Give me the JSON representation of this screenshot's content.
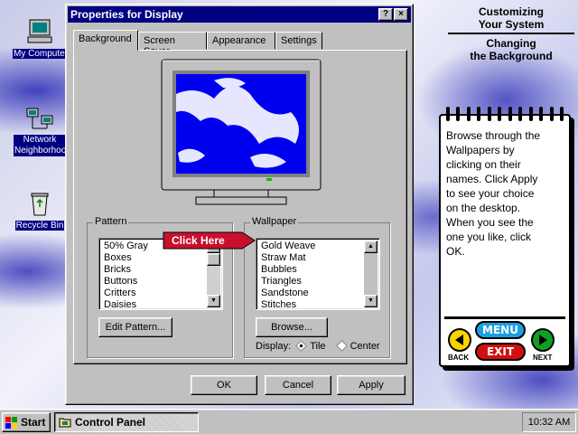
{
  "desktop": {
    "icons": [
      {
        "label": "My Computer",
        "icon": "computer-icon"
      },
      {
        "label": "Network Neighborhood",
        "icon": "network-icon"
      },
      {
        "label": "Recycle Bin",
        "icon": "recycle-bin-icon"
      }
    ]
  },
  "dialog": {
    "title": "Properties for Display",
    "help_button": "?",
    "close_button": "×",
    "tabs": [
      "Background",
      "Screen Saver",
      "Appearance",
      "Settings"
    ],
    "active_tab": "Background",
    "pattern": {
      "legend": "Pattern",
      "items": [
        "50% Gray",
        "Boxes",
        "Bricks",
        "Buttons",
        "Critters",
        "Daisies"
      ],
      "edit_button": "Edit Pattern..."
    },
    "wallpaper": {
      "legend": "Wallpaper",
      "items": [
        "Gold Weave",
        "Straw Mat",
        "Bubbles",
        "Triangles",
        "Sandstone",
        "Stitches"
      ],
      "browse_button": "Browse...",
      "display_label": "Display:",
      "display_options": [
        "Tile",
        "Center"
      ],
      "display_selected": "Tile"
    },
    "buttons": {
      "ok": "OK",
      "cancel": "Cancel",
      "apply": "Apply"
    }
  },
  "callout": {
    "text": "Click Here",
    "color": "#c8102e"
  },
  "tutorial": {
    "heading1": "Customizing\nYour System",
    "heading2": "Changing\nthe Background",
    "body": "Browse through the\nWallpapers by\nclicking on their\nnames.  Click Apply\nto see your choice\non the desktop.\nWhen you see the\none you like, click\nOK.",
    "menu_label": "MENU",
    "exit_label": "EXIT",
    "back_label": "BACK",
    "next_label": "NEXT",
    "colors": {
      "back": "#f5d400",
      "menu": "#1aa0e0",
      "exit": "#d01010",
      "next": "#10a020"
    }
  },
  "taskbar": {
    "start_label": "Start",
    "task_label": "Control Panel",
    "clock": "10:32 AM"
  }
}
